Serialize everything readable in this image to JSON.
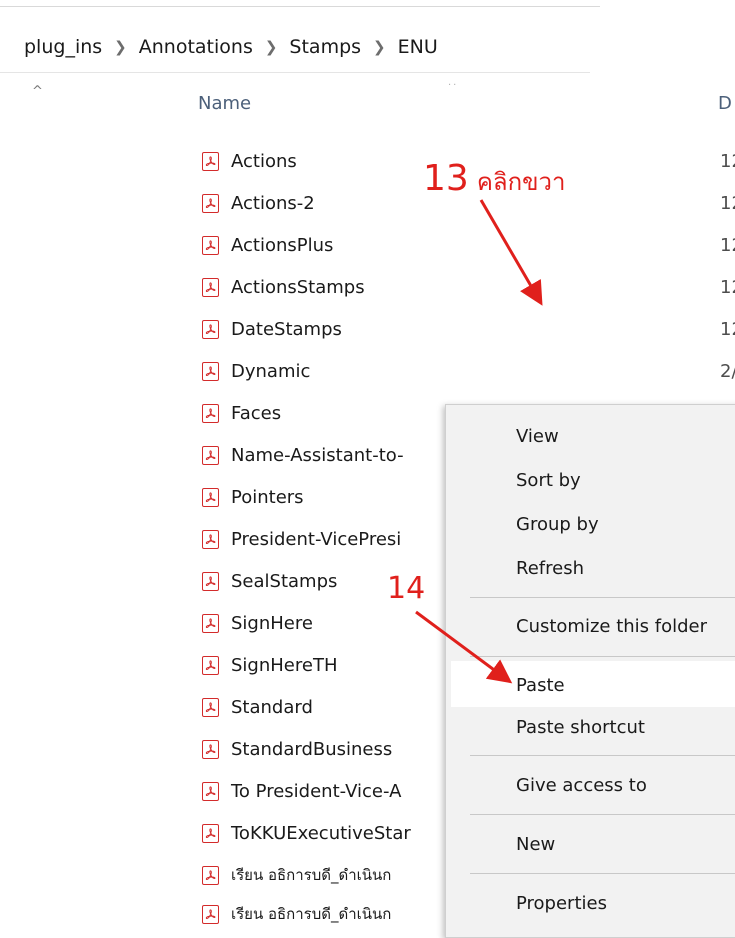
{
  "breadcrumb": [
    "plug_ins",
    "Annotations",
    "Stamps",
    "ENU"
  ],
  "columns": {
    "name": "Name",
    "date": "D",
    "sort_caret": "^",
    "divider_dots": "··"
  },
  "files": [
    {
      "name": "Actions",
      "date": "12"
    },
    {
      "name": "Actions-2",
      "date": "12"
    },
    {
      "name": "ActionsPlus",
      "date": "12"
    },
    {
      "name": "ActionsStamps",
      "date": "12"
    },
    {
      "name": "DateStamps",
      "date": "12"
    },
    {
      "name": "Dynamic",
      "date": "2/"
    },
    {
      "name": "Faces",
      "date": ""
    },
    {
      "name": "Name-Assistant-to-",
      "date": ""
    },
    {
      "name": "Pointers",
      "date": ""
    },
    {
      "name": "President-VicePresi",
      "date": ""
    },
    {
      "name": "SealStamps",
      "date": ""
    },
    {
      "name": "SignHere",
      "date": ""
    },
    {
      "name": "SignHereTH",
      "date": ""
    },
    {
      "name": "Standard",
      "date": ""
    },
    {
      "name": "StandardBusiness",
      "date": ""
    },
    {
      "name": "To President-Vice-A",
      "date": ""
    },
    {
      "name": "ToKKUExecutiveStar",
      "date": ""
    },
    {
      "name": "เรียน อธิการบดี_ดำเนินก",
      "date": ""
    },
    {
      "name": "เรียน อธิการบดี_ดำเนินก",
      "date": ""
    }
  ],
  "context_menu": {
    "view": "View",
    "sort_by": "Sort by",
    "group_by": "Group by",
    "refresh": "Refresh",
    "customize": "Customize this folder",
    "paste": "Paste",
    "paste_shortcut": "Paste shortcut",
    "give_access": "Give access to",
    "new": "New",
    "properties": "Properties",
    "highlighted": "Paste"
  },
  "annotations": {
    "step13_number": "13",
    "step13_text": "คลิกขวา",
    "step14_number": "14",
    "color": "#e0201c"
  },
  "icons": {
    "file": "pdf-file-icon"
  }
}
